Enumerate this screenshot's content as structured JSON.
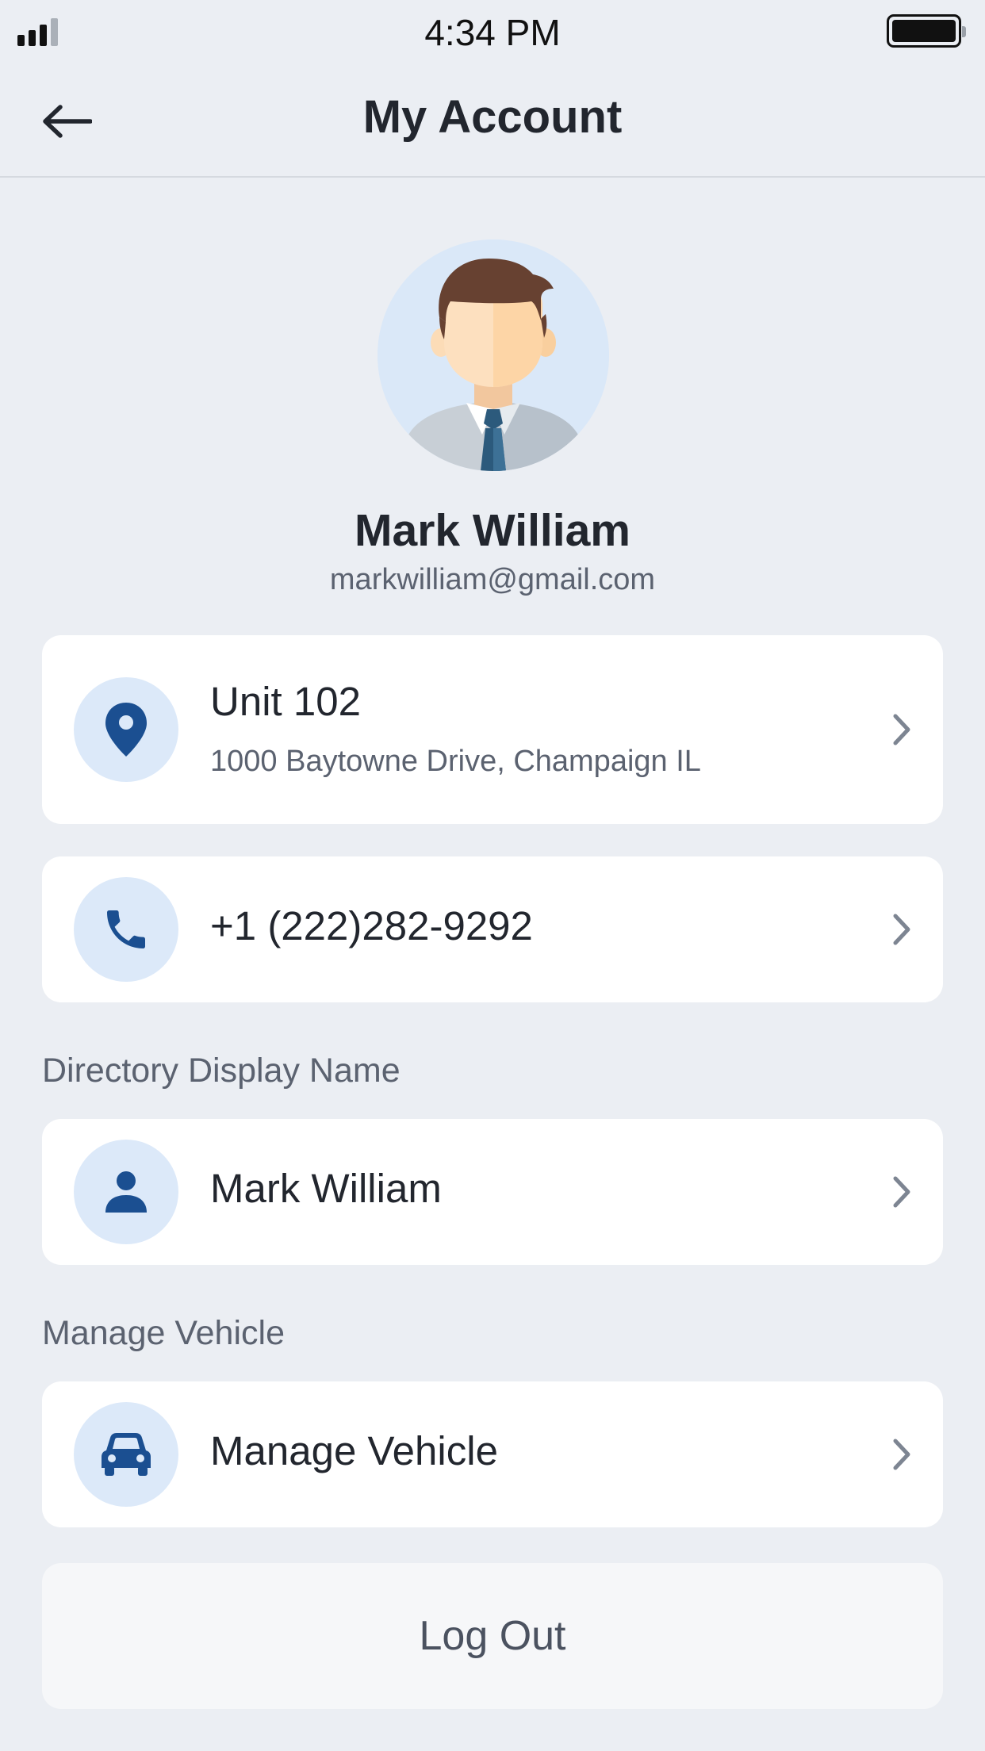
{
  "status_bar": {
    "time": "4:34 PM"
  },
  "nav": {
    "title": "My Account",
    "back_icon": "arrow-left-icon"
  },
  "profile": {
    "name": "Mark William",
    "email": "markwilliam@gmail.com",
    "avatar": "male-avatar-illustration"
  },
  "address": {
    "icon": "location-pin-icon",
    "unit": "Unit 102",
    "street": "1000 Baytowne Drive, Champaign IL"
  },
  "phone": {
    "icon": "phone-icon",
    "number": "+1 (222)282-9292"
  },
  "directory": {
    "section_label": "Directory Display Name",
    "icon": "person-icon",
    "display_name": "Mark William"
  },
  "vehicle": {
    "section_label": "Manage Vehicle",
    "icon": "car-icon",
    "label": "Manage Vehicle"
  },
  "logout": {
    "label": "Log Out"
  },
  "colors": {
    "background": "#ebeef3",
    "card": "#ffffff",
    "icon_circle": "#dce9f9",
    "icon_blue": "#1b4f91",
    "chevron": "#7d8592",
    "text_primary": "#22262e",
    "text_secondary": "#5b6270"
  }
}
